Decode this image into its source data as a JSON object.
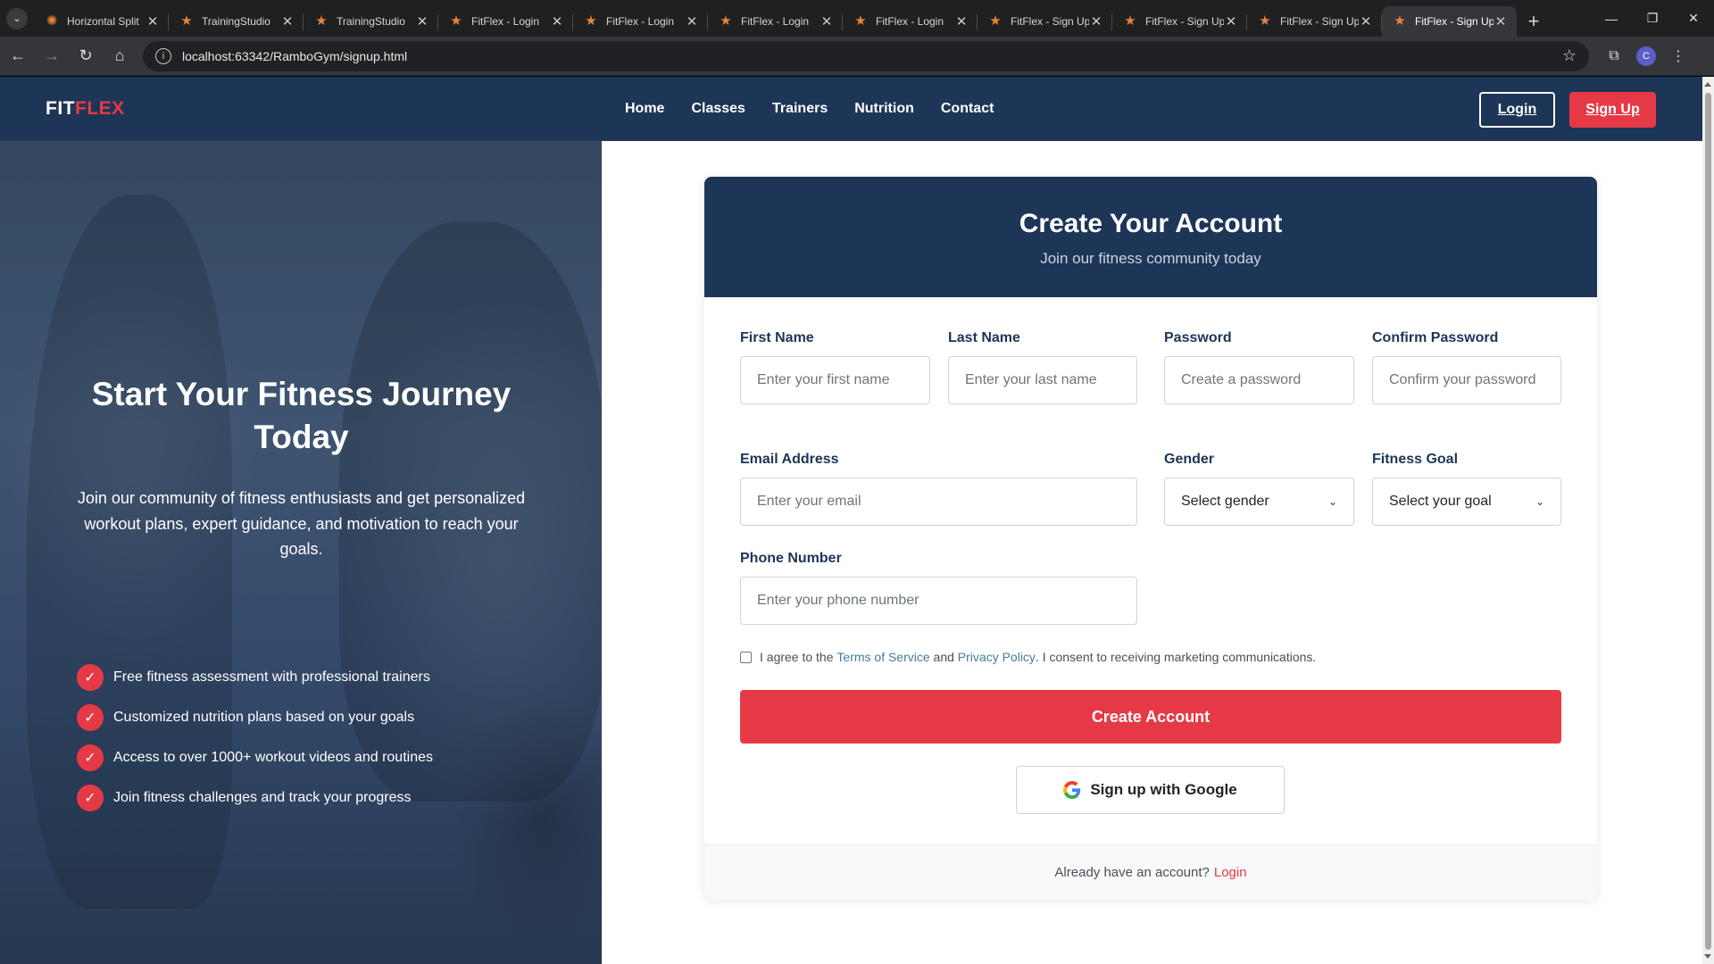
{
  "browser": {
    "tabs": [
      {
        "title": "Horizontal Split",
        "icon": "asterisk-favicon-icon"
      },
      {
        "title": "TrainingStudio",
        "icon": "star-favicon-icon"
      },
      {
        "title": "TrainingStudio",
        "icon": "star-favicon-icon"
      },
      {
        "title": "FitFlex - Login",
        "icon": "star-favicon-icon"
      },
      {
        "title": "FitFlex - Login",
        "icon": "star-favicon-icon"
      },
      {
        "title": "FitFlex - Login",
        "icon": "star-favicon-icon"
      },
      {
        "title": "FitFlex - Login",
        "icon": "star-favicon-icon"
      },
      {
        "title": "FitFlex - Sign Up",
        "icon": "star-favicon-icon"
      },
      {
        "title": "FitFlex - Sign Up",
        "icon": "star-favicon-icon"
      },
      {
        "title": "FitFlex - Sign Up",
        "icon": "star-favicon-icon"
      },
      {
        "title": "FitFlex - Sign Up",
        "icon": "star-favicon-icon",
        "active": true
      }
    ],
    "url": "localhost:63342/RamboGym/signup.html",
    "profile_initial": "C"
  },
  "nav": {
    "logo_a": "FIT",
    "logo_b": "FLEX",
    "links": [
      "Home",
      "Classes",
      "Trainers",
      "Nutrition",
      "Contact"
    ],
    "login": "Login",
    "signup": "Sign Up"
  },
  "hero": {
    "title": "Start Your Fitness Journey Today",
    "lead": "Join our community of fitness enthusiasts and get personalized workout plans, expert guidance, and motivation to reach your goals.",
    "features": [
      "Free fitness assessment with professional trainers",
      "Customized nutrition plans based on your goals",
      "Access to over 1000+ workout videos and routines",
      "Join fitness challenges and track your progress"
    ],
    "check_glyph": "✓"
  },
  "form": {
    "title": "Create Your Account",
    "subtitle": "Join our fitness community today",
    "first_name": {
      "label": "First Name",
      "placeholder": "Enter your first name"
    },
    "last_name": {
      "label": "Last Name",
      "placeholder": "Enter your last name"
    },
    "password": {
      "label": "Password",
      "placeholder": "Create a password"
    },
    "confirm_password": {
      "label": "Confirm Password",
      "placeholder": "Confirm your password"
    },
    "email": {
      "label": "Email Address",
      "placeholder": "Enter your email"
    },
    "gender": {
      "label": "Gender",
      "value": "Select gender"
    },
    "goal": {
      "label": "Fitness Goal",
      "value": "Select your goal"
    },
    "phone": {
      "label": "Phone Number",
      "placeholder": "Enter your phone number"
    },
    "terms": {
      "pre": "I agree to the",
      "tos": "Terms of Service",
      "and": "and",
      "privacy": "Privacy Policy",
      "post": ". I consent to receiving marketing communications."
    },
    "submit": "Create Account",
    "google": "Sign up with Google",
    "footer_text": "Already have an account?",
    "footer_link": "Login"
  },
  "colors": {
    "navy": "#1d3557",
    "accent": "#e63946",
    "link": "#457b9d"
  }
}
